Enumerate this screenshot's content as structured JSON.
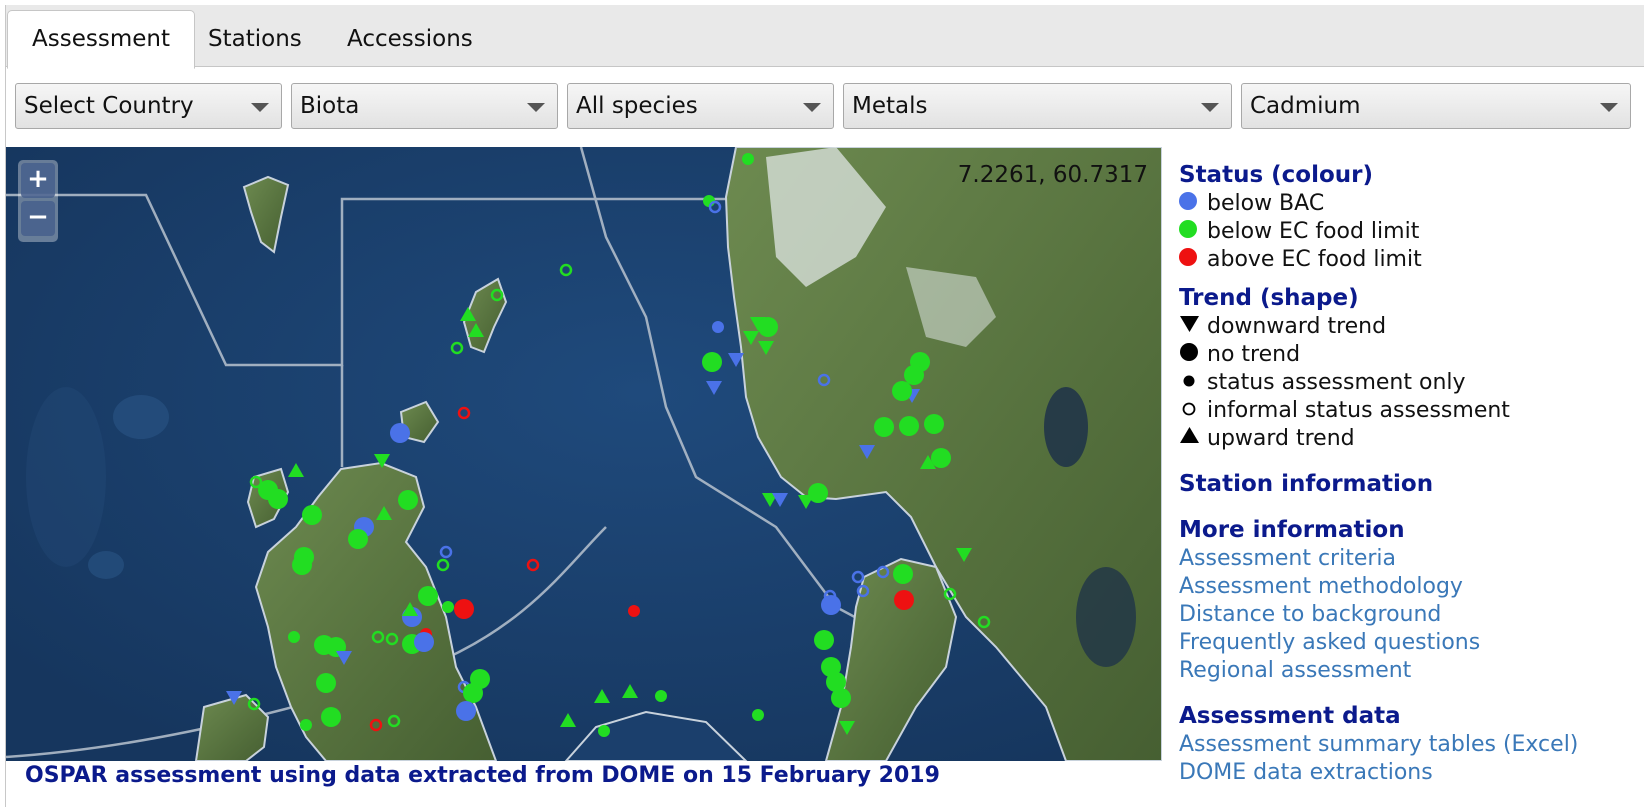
{
  "tabs": [
    {
      "label": "Assessment",
      "active": true
    },
    {
      "label": "Stations",
      "active": false
    },
    {
      "label": "Accessions",
      "active": false
    }
  ],
  "filters": {
    "country": "Select Country",
    "matrix": "Biota",
    "species": "All species",
    "group": "Metals",
    "determinand": "Cadmium"
  },
  "map": {
    "zoom_in": "+",
    "zoom_out": "−",
    "coordinates": "7.2261, 60.7317",
    "footer": "OSPAR assessment using data extracted from DOME on 15 February 2019"
  },
  "legend": {
    "status_title": "Status (colour)",
    "status": [
      {
        "label": "below BAC",
        "color": "#4a72e8"
      },
      {
        "label": "below EC food limit",
        "color": "#22dd22"
      },
      {
        "label": "above EC food limit",
        "color": "#ee1111"
      }
    ],
    "trend_title": "Trend (shape)",
    "trends": [
      {
        "label": "downward trend",
        "shape": "triangle-down"
      },
      {
        "label": "no trend",
        "shape": "large-circle"
      },
      {
        "label": "status assessment only",
        "shape": "small-circle"
      },
      {
        "label": "informal status assessment",
        "shape": "open-circle"
      },
      {
        "label": "upward trend",
        "shape": "triangle-up"
      }
    ],
    "station_info_title": "Station information",
    "more_info_title": "More information",
    "more_info_links": [
      "Assessment criteria",
      "Assessment methodology",
      "Distance to background",
      "Frequently asked questions",
      "Regional assessment"
    ],
    "data_title": "Assessment data",
    "data_links": [
      "Assessment summary tables (Excel)",
      "DOME data extractions"
    ]
  },
  "colors": {
    "heading": "#0b1a8c",
    "link": "#3a78b8",
    "sea": "#1b3f6c",
    "land": "#5d7a45"
  }
}
